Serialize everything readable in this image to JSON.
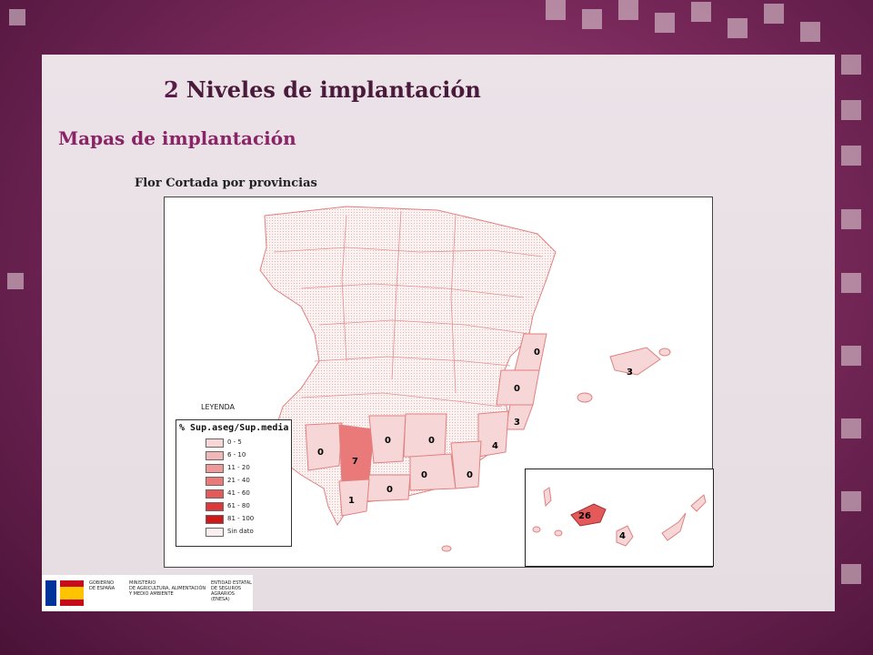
{
  "slide": {
    "number": "2",
    "title": "Niveles de implantación",
    "section": "Mapas de implantación",
    "map_caption": "Flor Cortada por provincias"
  },
  "legend": {
    "title": "LEYENDA",
    "header": "% Sup.aseg/Sup.media",
    "items": [
      {
        "label": "0 - 5",
        "color": "#f6d6d6"
      },
      {
        "label": "6 - 10",
        "color": "#f2b8b8"
      },
      {
        "label": "11 - 20",
        "color": "#ee9a9a"
      },
      {
        "label": "21 - 40",
        "color": "#ea7a7a"
      },
      {
        "label": "41 - 60",
        "color": "#e45a5a"
      },
      {
        "label": "61 - 80",
        "color": "#dc3a3a"
      },
      {
        "label": "81 - 100",
        "color": "#d01818"
      },
      {
        "label": "Sin dato",
        "color": "#fbeeee"
      }
    ]
  },
  "province_values": {
    "castellon": "0",
    "valencia": "0",
    "baleares": "3",
    "alicante": "3",
    "murcia": "4",
    "huelva": "0",
    "sevilla": "7",
    "cordoba": "0",
    "jaen": "0",
    "cadiz": "1",
    "malaga": "0",
    "granada": "0",
    "almeria": "0",
    "tenerife": "26",
    "las_palmas": "4"
  },
  "footer": {
    "gov_line1": "GOBIERNO",
    "gov_line2": "DE ESPAÑA",
    "min_line1": "MINISTERIO",
    "min_line2": "DE AGRICULTURA, ALIMENTACIÓN",
    "min_line3": "Y MEDIO AMBIENTE",
    "ent_line1": "ENTIDAD ESTATAL",
    "ent_line2": "DE SEGUROS",
    "ent_line3": "AGRARIOS (ENESA)"
  },
  "colors": {
    "title": "#4a1a3a",
    "section": "#8a2466",
    "background": "#7a2a5c"
  }
}
